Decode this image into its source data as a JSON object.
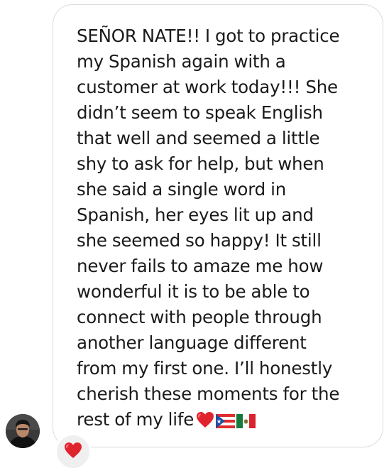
{
  "message": {
    "text": "SEÑOR NATE!! I got to practice\nmy Spanish again with a\ncustomer at work today!!! She\ndidn’t seem to speak English\nthat well and seemed a little\nshy to ask for help, but when\nshe said a single word in\nSpanish, her eyes lit up and\nshe seemed so happy! It still\nnever fails to amaze me how\nwonderful it is to be able to\nconnect with people through\nanother language different\nfrom my first one. I’ll honestly\ncherish these moments for the\nrest of my life",
    "trailing_emojis": [
      "red-heart-icon",
      "puerto-rico-flag-icon",
      "mexico-flag-icon"
    ]
  },
  "sender": {
    "avatar_icon": "profile-photo"
  },
  "reaction": {
    "icon": "red-heart-icon",
    "color": "#e0242e"
  },
  "colors": {
    "bubble_border": "#dbdbdb",
    "text": "#1a1a1a",
    "reaction_background": "#efefef"
  }
}
